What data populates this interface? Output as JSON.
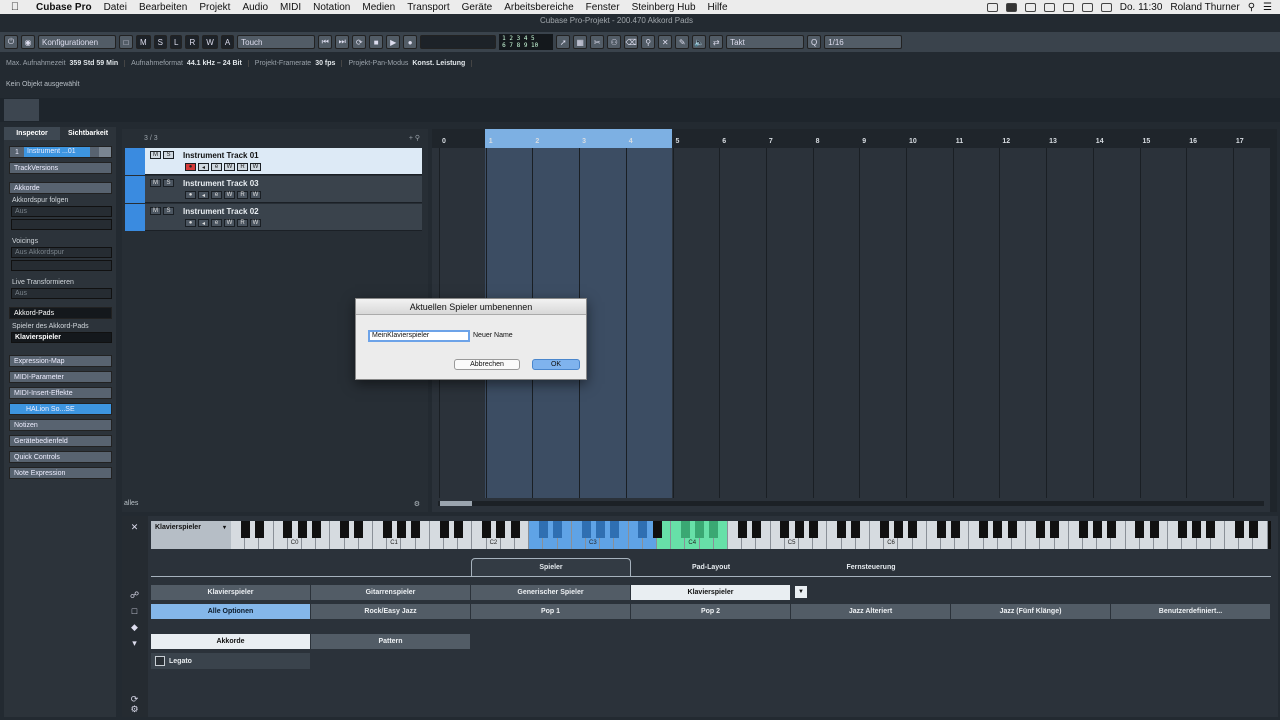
{
  "menubar": {
    "app": "Cubase Pro",
    "items": [
      "Datei",
      "Bearbeiten",
      "Projekt",
      "Audio",
      "MIDI",
      "Notation",
      "Medien",
      "Transport",
      "Geräte",
      "Arbeitsbereiche",
      "Fenster",
      "Steinberg Hub",
      "Hilfe"
    ],
    "clock": "Do. 11:30",
    "user": "Roland Thurner"
  },
  "window_title": "Cubase Pro-Projekt - 200.470 Akkord Pads",
  "toolbar": {
    "config": "Konfigurationen",
    "modes": [
      "M",
      "S",
      "L",
      "R",
      "W",
      "A"
    ],
    "automation": "Touch",
    "counter_top": "1 2 3 4 5",
    "counter_bottom": "6 7 8 9 10",
    "grid_type": "Takt",
    "quantize": "1/16"
  },
  "status": [
    {
      "label": "Max. Aufnahmezeit",
      "value": "359 Std 59 Min"
    },
    {
      "label": "Aufnahmeformat",
      "value": "44.1 kHz – 24 Bit"
    },
    {
      "label": "Projekt-Framerate",
      "value": "30 fps"
    },
    {
      "label": "Projekt-Pan-Modus",
      "value": "Konst. Leistung"
    }
  ],
  "info_line": "Kein Objekt ausgewählt",
  "inspector": {
    "tabs": [
      "Inspector",
      "Sichtbarkeit"
    ],
    "track_index": "1",
    "track_field": "Instrument ...01",
    "track_versions": "TrackVersions",
    "akkorde": "Akkorde",
    "akkordspur_folgen": "Akkordspur folgen",
    "aus1": "Aus",
    "voicings": "Voicings",
    "aus_akkordspur": "Aus Akkordspur",
    "live_transformieren": "Live Transformieren",
    "aus2": "Aus",
    "akkord_pads": "Akkord-Pads",
    "spieler_label": "Spieler des Akkord-Pads",
    "spieler_value": "Klavierspieler",
    "expression_map": "Expression-Map",
    "midi_parameter": "MIDI-Parameter",
    "midi_insert": "MIDI-Insert-Effekte",
    "halion": "HALion So...SE",
    "notizen": "Notizen",
    "geraetebedienfeld": "Gerätebedienfeld",
    "quick_controls": "Quick Controls",
    "note_expression": "Note Expression"
  },
  "tracklist": {
    "count": "3 / 3",
    "tracks": [
      {
        "name": "Instrument Track 01"
      },
      {
        "name": "Instrument Track 03"
      },
      {
        "name": "Instrument Track 02"
      }
    ],
    "footer": "alles",
    "ms": [
      "M",
      "S"
    ],
    "ctl": [
      "●",
      "◂",
      "e",
      "W",
      "R",
      "W"
    ]
  },
  "ruler": {
    "ticks": [
      "0",
      "1",
      "2",
      "3",
      "4",
      "5",
      "6",
      "7",
      "8",
      "9",
      "10",
      "11",
      "12",
      "13",
      "14",
      "15",
      "16",
      "17"
    ]
  },
  "dialog": {
    "title": "Aktuellen Spieler umbenennen",
    "input_value": "MeinKlavierspieler",
    "field_label": "Neuer Name",
    "cancel": "Abbrechen",
    "ok": "OK"
  },
  "lower": {
    "keyboard_label": "Klavierspieler",
    "octaves": [
      "C0",
      "C1",
      "C2",
      "C3",
      "C4",
      "C5",
      "C6"
    ],
    "tabs": [
      "Spieler",
      "Pad-Layout",
      "Fernsteuerung"
    ],
    "players": [
      "Klavierspieler",
      "Gitarrenspieler",
      "Generischer Spieler"
    ],
    "player_dropdown": "Klavierspieler",
    "styles": [
      "Alle Optionen",
      "Rock/Easy Jazz",
      "Pop 1",
      "Pop 2",
      "Jazz Alteriert",
      "Jazz (Fünf Klänge)",
      "Benutzerdefiniert..."
    ],
    "subtabs": [
      "Akkorde",
      "Pattern"
    ],
    "legato": "Legato"
  },
  "colors": {
    "accent_blue": "#3d95e0",
    "track_color": "#3a8be0",
    "cycle_range": "#7db0e3",
    "chord_green": "#67e0a8",
    "record_red": "#d53a3a"
  }
}
